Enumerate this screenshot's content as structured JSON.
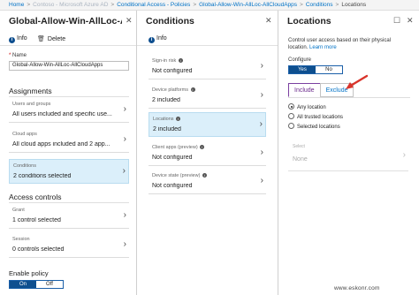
{
  "breadcrumb": {
    "items": [
      "Home",
      "Contoso - Microsoft Azure AD",
      "Conditional Access - Policies",
      "Global-Allow-Win-AllLoc-AllCloudApps",
      "Conditions",
      "Locations"
    ],
    "separator": ">"
  },
  "policy_blade": {
    "title": "Global-Allow-Win-AllLoc-All...",
    "info_label": "Info",
    "delete_label": "Delete",
    "name_label": "Name",
    "name_required": "*",
    "name_value": "Global-Allow-Win-AllLoc-AllCloudApps",
    "assignments_heading": "Assignments",
    "assignments": [
      {
        "label": "Users and groups",
        "value": "All users included and specific use..."
      },
      {
        "label": "Cloud apps",
        "value": "All cloud apps included and 2 app..."
      },
      {
        "label": "Conditions",
        "value": "2 conditions selected"
      }
    ],
    "access_controls_heading": "Access controls",
    "access_controls": [
      {
        "label": "Grant",
        "value": "1 control selected"
      },
      {
        "label": "Session",
        "value": "0 controls selected"
      }
    ],
    "enable_policy_label": "Enable policy",
    "enable_on": "On",
    "enable_off": "Off",
    "enable_state": "On"
  },
  "conditions_blade": {
    "title": "Conditions",
    "info_label": "Info",
    "items": [
      {
        "label": "Sign-in risk",
        "value": "Not configured"
      },
      {
        "label": "Device platforms",
        "value": "2 included"
      },
      {
        "label": "Locations",
        "value": "2 included"
      },
      {
        "label": "Client apps (preview)",
        "value": "Not configured"
      },
      {
        "label": "Device state (preview)",
        "value": "Not configured"
      }
    ],
    "selected": "Locations"
  },
  "locations_blade": {
    "title": "Locations",
    "description": "Control user access based on their physical location.",
    "learn_more": "Learn more",
    "configure_label": "Configure",
    "configure_yes": "Yes",
    "configure_no": "No",
    "configure_state": "Yes",
    "tabs": [
      "Include",
      "Exclude"
    ],
    "active_tab": "Include",
    "radios": [
      "Any location",
      "All trusted locations",
      "Selected locations"
    ],
    "selected_radio": "Any location",
    "select_label": "Select",
    "select_value": "None"
  },
  "icons": {
    "window_controls": [
      "minimize-icon",
      "maximize-icon",
      "close-icon"
    ],
    "info": "info-icon",
    "delete": "trash-icon",
    "chevron": "chevron-right-icon",
    "annotation": "red-arrow-icon"
  },
  "colors": {
    "accent": "#0e4f8f",
    "link": "#0072c6",
    "selected_tile": "#dbeffa",
    "annotation_arrow": "#d9342b"
  },
  "watermark": "www.eskonr.com"
}
